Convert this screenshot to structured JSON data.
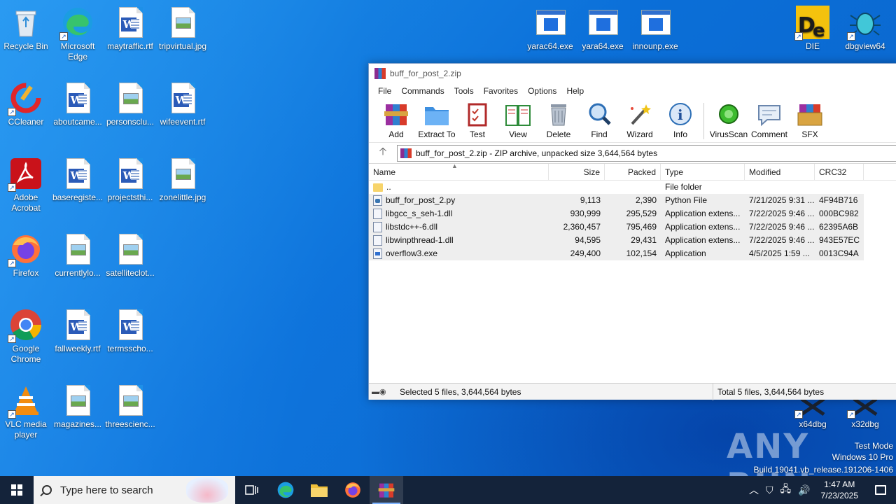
{
  "desktop": {
    "icons": [
      {
        "label": "Recycle Bin",
        "icon": "recycle-bin-icon"
      },
      {
        "label": "Microsoft Edge",
        "icon": "edge-icon"
      },
      {
        "label": "maytraffic.rtf",
        "icon": "word-doc-icon"
      },
      {
        "label": "tripvirtual.jpg",
        "icon": "image-file-icon"
      },
      {
        "label": "CCleaner",
        "icon": "ccleaner-icon"
      },
      {
        "label": "aboutcame...",
        "icon": "word-doc-icon"
      },
      {
        "label": "personsclu...",
        "icon": "image-file-icon"
      },
      {
        "label": "wifeevent.rtf",
        "icon": "word-doc-icon"
      },
      {
        "label": "Adobe Acrobat",
        "icon": "acrobat-icon"
      },
      {
        "label": "baseregiste...",
        "icon": "word-doc-icon"
      },
      {
        "label": "projectsthi...",
        "icon": "word-doc-icon"
      },
      {
        "label": "zonelittle.jpg",
        "icon": "image-file-icon"
      },
      {
        "label": "Firefox",
        "icon": "firefox-icon"
      },
      {
        "label": "currentlylo...",
        "icon": "image-file-icon"
      },
      {
        "label": "satelliteclot...",
        "icon": "image-file-icon"
      },
      {
        "label": "Google Chrome",
        "icon": "chrome-icon"
      },
      {
        "label": "fallweekly.rtf",
        "icon": "word-doc-icon"
      },
      {
        "label": "termsscho...",
        "icon": "word-doc-icon"
      },
      {
        "label": "VLC media player",
        "icon": "vlc-icon"
      },
      {
        "label": "magazines...",
        "icon": "image-file-icon"
      },
      {
        "label": "threescienc...",
        "icon": "image-file-icon"
      },
      {
        "label": "yarac64.exe",
        "icon": "exe-icon"
      },
      {
        "label": "yara64.exe",
        "icon": "exe-icon"
      },
      {
        "label": "innounp.exe",
        "icon": "exe-icon"
      },
      {
        "label": "DIE",
        "icon": "die-icon"
      },
      {
        "label": "dbgview64",
        "icon": "dbgview-icon"
      },
      {
        "label": "x64dbg",
        "icon": "x64dbg-icon"
      },
      {
        "label": "x32dbg",
        "icon": "x32dbg-icon"
      }
    ]
  },
  "winrar": {
    "title": "buff_for_post_2.zip",
    "menu": [
      "File",
      "Commands",
      "Tools",
      "Favorites",
      "Options",
      "Help"
    ],
    "toolbar": [
      "Add",
      "Extract To",
      "Test",
      "View",
      "Delete",
      "Find",
      "Wizard",
      "Info",
      "VirusScan",
      "Comment",
      "SFX"
    ],
    "address": "buff_for_post_2.zip - ZIP archive, unpacked size 3,644,564 bytes",
    "columns": {
      "name": "Name",
      "size": "Size",
      "packed": "Packed",
      "type": "Type",
      "modified": "Modified",
      "crc": "CRC32"
    },
    "files": [
      {
        "name": "..",
        "size": "",
        "packed": "",
        "type": "File folder",
        "modified": "",
        "crc": "",
        "kind": "folder"
      },
      {
        "name": "buff_for_post_2.py",
        "size": "9,113",
        "packed": "2,390",
        "type": "Python File",
        "modified": "7/21/2025 9:31 ...",
        "crc": "4F94B716",
        "kind": "py"
      },
      {
        "name": "libgcc_s_seh-1.dll",
        "size": "930,999",
        "packed": "295,529",
        "type": "Application extens...",
        "modified": "7/22/2025 9:46 ...",
        "crc": "000BC982",
        "kind": "dll"
      },
      {
        "name": "libstdc++-6.dll",
        "size": "2,360,457",
        "packed": "795,469",
        "type": "Application extens...",
        "modified": "7/22/2025 9:46 ...",
        "crc": "62395A6B",
        "kind": "dll"
      },
      {
        "name": "libwinpthread-1.dll",
        "size": "94,595",
        "packed": "29,431",
        "type": "Application extens...",
        "modified": "7/22/2025 9:46 ...",
        "crc": "943E57EC",
        "kind": "dll"
      },
      {
        "name": "overflow3.exe",
        "size": "249,400",
        "packed": "102,154",
        "type": "Application",
        "modified": "4/5/2025 1:59 ...",
        "crc": "0013C94A",
        "kind": "exe"
      }
    ],
    "status_left": "Selected 5 files, 3,644,564 bytes",
    "status_right": "Total 5 files, 3,644,564 bytes"
  },
  "watermark": {
    "logo": "ANY RUN",
    "line1": "Test Mode",
    "line2": "Windows 10 Pro",
    "line3": "Build 19041.vb_release.191206-1406"
  },
  "taskbar": {
    "search_placeholder": "Type here to search",
    "time": "1:47 AM",
    "date": "7/23/2025"
  }
}
